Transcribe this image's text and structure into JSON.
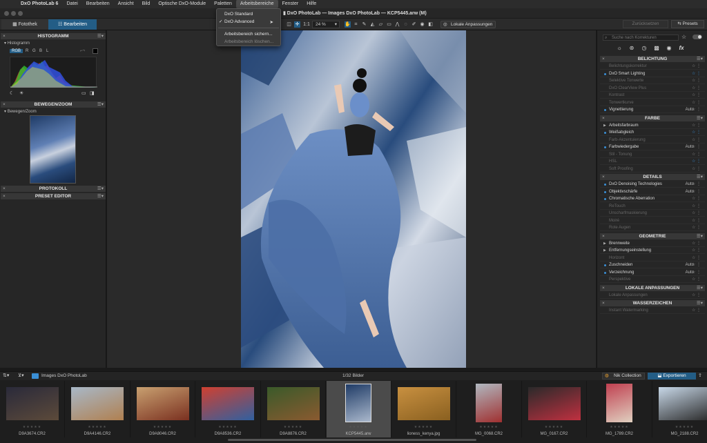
{
  "menubar": {
    "app_name": "DxO PhotoLab 6",
    "items": [
      "Datei",
      "Bearbeiten",
      "Ansicht",
      "Bild",
      "Optische DxO-Module",
      "Paletten",
      "Arbeitsbereiche",
      "Fenster",
      "Hilfe"
    ],
    "active": "Arbeitsbereiche"
  },
  "window": {
    "title": "DxO PhotoLab — Images DxO PhotoLab — KCP5445.arw (M)"
  },
  "dropdown": {
    "items": [
      {
        "label": "DxO Standard",
        "checked": false,
        "enabled": true
      },
      {
        "label": "DxO Advanced",
        "checked": true,
        "enabled": true
      },
      {
        "label": "Arbeitsbereich sichern...",
        "checked": false,
        "enabled": true
      },
      {
        "label": "Arbeitsbereich löschen...",
        "checked": false,
        "enabled": false
      }
    ],
    "check_mark": "✓"
  },
  "toolbar": {
    "tab_library": "Fotothek",
    "tab_edit": "Bearbeiten",
    "ratio_label": "1:1",
    "zoom": "24 %",
    "local_adjust": "Lokale Anpassungen",
    "reset": "Zurücksetzen",
    "presets": "Presets"
  },
  "left_panel": {
    "histogram_title": "HISTOGRAMM",
    "histogram_sub": "Histogramm",
    "channels": [
      "RGB",
      "R",
      "G",
      "B",
      "L"
    ],
    "nav_title": "BEWEGEN/ZOOM",
    "nav_sub": "Bewegen/Zoom",
    "history_title": "PROTOKOLL",
    "preset_title": "PRESET EDITOR"
  },
  "right_panel": {
    "search_placeholder": "Suche nach Korrekturen",
    "sections": [
      {
        "title": "BELICHTUNG",
        "items": [
          {
            "label": "Belichtungskorrektur",
            "active": false,
            "auto": "",
            "fav": false
          },
          {
            "label": "DxO Smart Lighting",
            "active": true,
            "auto": "",
            "fav": true
          },
          {
            "label": "Selektive Tonwerte",
            "active": false,
            "auto": "",
            "fav": false
          },
          {
            "label": "DxO ClearView Plus",
            "active": false,
            "auto": "",
            "fav": false
          },
          {
            "label": "Kontrast",
            "active": false,
            "auto": "",
            "fav": false
          },
          {
            "label": "Tonwertkurve",
            "active": false,
            "auto": "",
            "fav": false
          },
          {
            "label": "Vignettierung",
            "active": true,
            "auto": "Auto",
            "fav": false
          }
        ]
      },
      {
        "title": "FARBE",
        "items": [
          {
            "label": "Arbeitsfarbraum",
            "active": true,
            "auto": "",
            "fav": false,
            "tri": true
          },
          {
            "label": "Weißabgleich",
            "active": true,
            "auto": "",
            "fav": true
          },
          {
            "label": "Farb-Akzentuierung",
            "active": false,
            "auto": "",
            "fav": false
          },
          {
            "label": "Farbwiedergabe",
            "active": true,
            "auto": "Auto",
            "fav": false
          },
          {
            "label": "Stil - Tonung",
            "active": false,
            "auto": "",
            "fav": false
          },
          {
            "label": "HSL",
            "active": false,
            "auto": "",
            "fav": true
          },
          {
            "label": "Soft Proofing",
            "active": false,
            "auto": "",
            "fav": false
          }
        ]
      },
      {
        "title": "DETAILS",
        "items": [
          {
            "label": "DxO Denoising Technologies",
            "active": true,
            "auto": "Auto",
            "fav": false
          },
          {
            "label": "Objektivschärfe",
            "active": true,
            "auto": "Auto",
            "fav": false
          },
          {
            "label": "Chromatische Aberration",
            "active": true,
            "auto": "",
            "fav": false
          },
          {
            "label": "ReTouch",
            "active": false,
            "auto": "",
            "fav": false
          },
          {
            "label": "Unscharfmaskierung",
            "active": false,
            "auto": "",
            "fav": false
          },
          {
            "label": "Moiré",
            "active": false,
            "auto": "",
            "fav": false
          },
          {
            "label": "Rote Augen",
            "active": false,
            "auto": "",
            "fav": false
          }
        ]
      },
      {
        "title": "GEOMETRIE",
        "items": [
          {
            "label": "Brennweite",
            "active": true,
            "auto": "",
            "fav": false,
            "tri": true
          },
          {
            "label": "Entfernungseinstellung",
            "active": true,
            "auto": "",
            "fav": false,
            "tri": true
          },
          {
            "label": "Horizont",
            "active": false,
            "auto": "",
            "fav": false
          },
          {
            "label": "Zuschneiden",
            "active": true,
            "auto": "Auto",
            "fav": false
          },
          {
            "label": "Verzeichnung",
            "active": true,
            "auto": "Auto",
            "fav": false
          },
          {
            "label": "Perspektive",
            "active": false,
            "auto": "",
            "fav": false
          }
        ]
      },
      {
        "title": "LOKALE ANPASSUNGEN",
        "items": [
          {
            "label": "Lokale Anpassungen",
            "active": false,
            "auto": "",
            "fav": false
          }
        ]
      },
      {
        "title": "WASSERZEICHEN",
        "items": [
          {
            "label": "Instant Watermarking",
            "active": false,
            "auto": "",
            "fav": false
          }
        ]
      }
    ]
  },
  "filmstrip": {
    "folder": "Images DxO PhotoLab",
    "count": "1/32 Bilder",
    "nik": "Nik Collection",
    "export": "Exportieren",
    "stars": "★★★★★",
    "items": [
      {
        "name": "D9A3674.CR2",
        "selected": false,
        "orient": "land",
        "c1": "#2a2a3a",
        "c2": "#5c4a3a"
      },
      {
        "name": "D9A4146.CR2",
        "selected": false,
        "orient": "land",
        "c1": "#a8b8c8",
        "c2": "#b08050"
      },
      {
        "name": "D9A8046.CR2",
        "selected": false,
        "orient": "land",
        "c1": "#c8a070",
        "c2": "#7a3020"
      },
      {
        "name": "D9A8536.CR2",
        "selected": false,
        "orient": "land",
        "c1": "#d04030",
        "c2": "#3060a0"
      },
      {
        "name": "D9A8876.CR2",
        "selected": false,
        "orient": "land",
        "c1": "#3a5a2a",
        "c2": "#8a5a30"
      },
      {
        "name": "KCP5445.arw",
        "selected": true,
        "orient": "port",
        "c1": "#1f3b66",
        "c2": "#aab8cc"
      },
      {
        "name": "lioness_kenya.jpg",
        "selected": false,
        "orient": "land",
        "c1": "#c89040",
        "c2": "#8a6020"
      },
      {
        "name": "MG_0068.CR2",
        "selected": false,
        "orient": "port",
        "c1": "#b0b8c0",
        "c2": "#a03030"
      },
      {
        "name": "MG_0167.CR2",
        "selected": false,
        "orient": "land",
        "c1": "#2a2a2a",
        "c2": "#c03040"
      },
      {
        "name": "MG_1789.CR2",
        "selected": false,
        "orient": "port",
        "c1": "#c04050",
        "c2": "#e0d0c0"
      },
      {
        "name": "MG_2188.CR2",
        "selected": false,
        "orient": "land",
        "c1": "#c8d8e8",
        "c2": "#2a2a2a"
      }
    ]
  }
}
